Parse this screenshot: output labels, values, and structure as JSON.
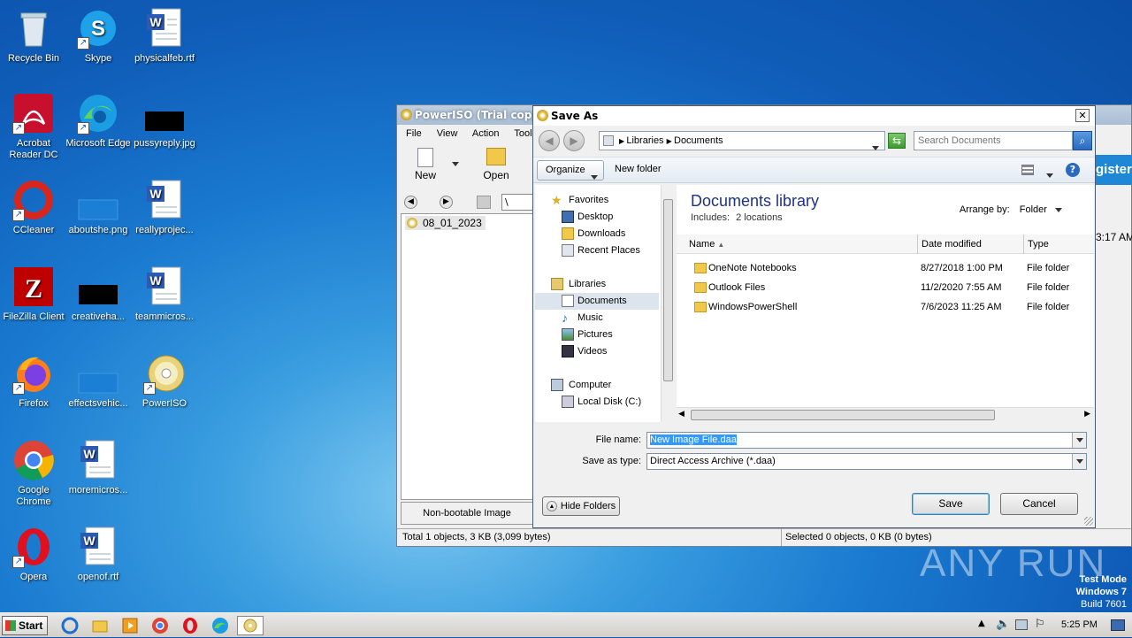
{
  "desktop": {
    "icons": [
      {
        "label": "Recycle Bin"
      },
      {
        "label": "Skype"
      },
      {
        "label": "physicalfeb.rtf"
      },
      {
        "label": "Acrobat Reader DC"
      },
      {
        "label": "Microsoft Edge"
      },
      {
        "label": "pussyreply.jpg"
      },
      {
        "label": "CCleaner"
      },
      {
        "label": "aboutshe.png"
      },
      {
        "label": "reallyprojec..."
      },
      {
        "label": "FileZilla Client"
      },
      {
        "label": "creativeha..."
      },
      {
        "label": "teammicros..."
      },
      {
        "label": "Firefox"
      },
      {
        "label": "effectsvehic..."
      },
      {
        "label": "PowerISO"
      },
      {
        "label": "Google Chrome"
      },
      {
        "label": "moremicros..."
      },
      {
        "label": "Opera"
      },
      {
        "label": "openof.rtf"
      }
    ],
    "watermark": "ANY RUN",
    "test_mode": [
      "Test Mode",
      "Windows 7",
      "Build 7601"
    ]
  },
  "poweriso": {
    "title": "PowerISO (Trial copy) -",
    "menu": [
      "File",
      "View",
      "Action",
      "Tools"
    ],
    "toolbar": {
      "new": "New",
      "open": "Open"
    },
    "path": "\\",
    "tree_item": "08_01_2023",
    "boot_status": "Non-bootable Image",
    "status_left": "Total 1 objects, 3 KB (3,099 bytes)",
    "status_right": "Selected 0 objects, 0 KB (0 bytes)",
    "register": "gister",
    "time_partial": "3:17 AM"
  },
  "save_as": {
    "title": "Save As",
    "breadcrumb": [
      "Libraries",
      "Documents"
    ],
    "search_placeholder": "Search Documents",
    "organize": "Organize",
    "new_folder": "New folder",
    "sidebar": {
      "favorites": "Favorites",
      "desktop": "Desktop",
      "downloads": "Downloads",
      "recent": "Recent Places",
      "libraries": "Libraries",
      "documents": "Documents",
      "music": "Music",
      "pictures": "Pictures",
      "videos": "Videos",
      "computer": "Computer",
      "local_disk": "Local Disk (C:)"
    },
    "library_title": "Documents library",
    "includes": "Includes:",
    "locations": "2 locations",
    "arrange_by_label": "Arrange by:",
    "arrange_by_value": "Folder",
    "columns": {
      "name": "Name",
      "date": "Date modified",
      "type": "Type"
    },
    "files": [
      {
        "name": "OneNote Notebooks",
        "date": "8/27/2018 1:00 PM",
        "type": "File folder"
      },
      {
        "name": "Outlook Files",
        "date": "11/2/2020 7:55 AM",
        "type": "File folder"
      },
      {
        "name": "WindowsPowerShell",
        "date": "7/6/2023 11:25 AM",
        "type": "File folder"
      }
    ],
    "file_name_label": "File name:",
    "file_name_value": "New Image File.daa",
    "save_type_label": "Save as type:",
    "save_type_value": "Direct Access Archive (*.daa)",
    "hide_folders": "Hide Folders",
    "save": "Save",
    "cancel": "Cancel"
  },
  "taskbar": {
    "start": "Start",
    "clock": "5:25 PM"
  }
}
